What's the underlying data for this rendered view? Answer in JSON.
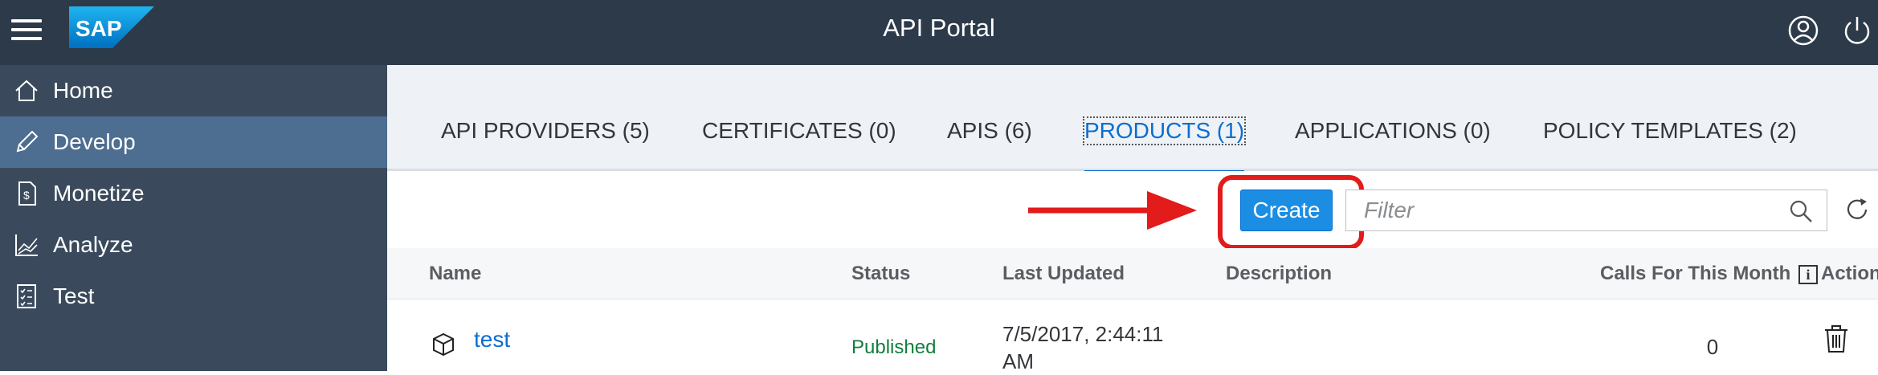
{
  "header": {
    "title": "API Portal",
    "logo_text": "SAP"
  },
  "sidebar": {
    "items": [
      {
        "label": "Home",
        "icon": "home-icon",
        "active": false
      },
      {
        "label": "Develop",
        "icon": "pencil-icon",
        "active": true
      },
      {
        "label": "Monetize",
        "icon": "invoice-icon",
        "active": false
      },
      {
        "label": "Analyze",
        "icon": "line-chart-icon",
        "active": false
      },
      {
        "label": "Test",
        "icon": "checklist-icon",
        "active": false
      }
    ]
  },
  "tabs": [
    {
      "label": "API PROVIDERS (5)",
      "active": false
    },
    {
      "label": "CERTIFICATES (0)",
      "active": false
    },
    {
      "label": "APIS (6)",
      "active": false
    },
    {
      "label": "PRODUCTS (1)",
      "active": true
    },
    {
      "label": "APPLICATIONS (0)",
      "active": false
    },
    {
      "label": "POLICY TEMPLATES (2)",
      "active": false
    }
  ],
  "toolbar": {
    "create_label": "Create",
    "filter_placeholder": "Filter",
    "filter_value": ""
  },
  "table": {
    "columns": {
      "name": "Name",
      "status": "Status",
      "last_updated": "Last Updated",
      "description": "Description",
      "calls": "Calls For This Month",
      "info": "i",
      "actions": "Actions"
    },
    "rows": [
      {
        "name": "test",
        "status": "Published",
        "last_updated": "7/5/2017, 2:44:11 AM",
        "description": "",
        "calls": "0"
      }
    ]
  },
  "colors": {
    "topbar": "#2d3a4a",
    "sidebar": "#3a4a5c",
    "sidebar_active": "#4d6d91",
    "accent": "#0a6ed1",
    "create_button": "#1b8ee3",
    "annotation_red": "#e21b1b",
    "status_published": "#107e3e"
  }
}
